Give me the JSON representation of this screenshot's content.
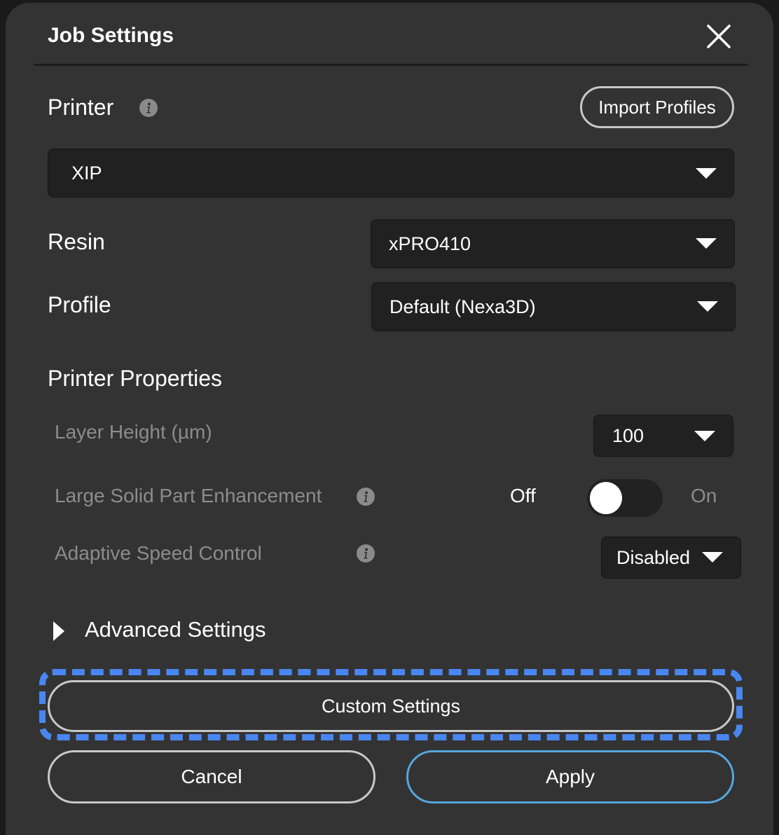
{
  "dialog": {
    "title": "Job Settings",
    "close_icon": "close-icon"
  },
  "printer": {
    "label": "Printer",
    "info_icon": "info-icon",
    "import_label": "Import Profiles",
    "selected": "XIP"
  },
  "resin": {
    "label": "Resin",
    "selected": "xPRO410"
  },
  "profile": {
    "label": "Profile",
    "selected": "Default (Nexa3D)"
  },
  "properties": {
    "heading": "Printer Properties",
    "layer_height": {
      "label": "Layer Height (µm)",
      "selected": "100"
    },
    "large_solid": {
      "label": "Large Solid Part Enhancement",
      "off_label": "Off",
      "on_label": "On",
      "state": "Off"
    },
    "adaptive_speed": {
      "label": "Adaptive Speed Control",
      "selected": "Disabled"
    }
  },
  "advanced": {
    "label": "Advanced Settings",
    "icon": "triangle-right-icon"
  },
  "buttons": {
    "custom_settings": "Custom Settings",
    "cancel": "Cancel",
    "apply": "Apply"
  },
  "colors": {
    "dialog_bg": "#333333",
    "select_bg": "#212121",
    "focus_dash": "#4a86f0",
    "apply_border": "#55a6dc",
    "muted_text": "#8c8c8c"
  }
}
